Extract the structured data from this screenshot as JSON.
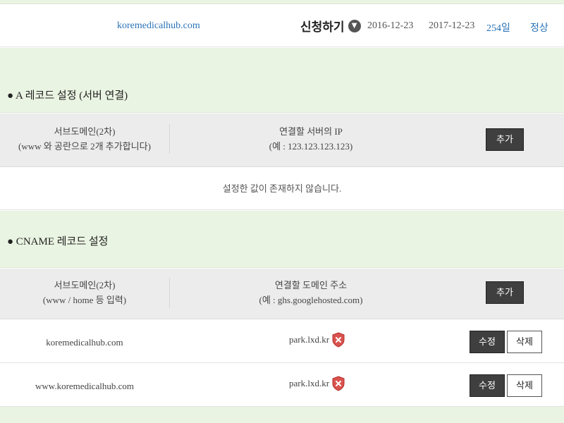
{
  "domain_row": {
    "domain": "koremedicalhub.com",
    "apply_label": "신청하기",
    "start_date": "2016-12-23",
    "end_date": "2017-12-23",
    "days_left": "254일",
    "status": "정상"
  },
  "a_record": {
    "title": "● A 레코드 설정 (서버 연결)",
    "col1_line1": "서브도메인(2차)",
    "col1_line2": "(www 와 공란으로 2개 추가합니다)",
    "col2_line1": "연결할 서버의 IP",
    "col2_line2": "(예 : 123.123.123.123)",
    "add_label": "추가",
    "empty_message": "설정한 값이 존재하지 않습니다."
  },
  "cname_record": {
    "title": "● CNAME 레코드 설정",
    "col1_line1": "서브도메인(2차)",
    "col1_line2": "(www / home 등 입력)",
    "col2_line1": "연결할 도메인 주소",
    "col2_line2": "(예 : ghs.googlehosted.com)",
    "add_label": "추가",
    "rows": [
      {
        "subdomain": "koremedicalhub.com",
        "target": "park.lxd.kr",
        "edit_label": "수정",
        "delete_label": "삭제"
      },
      {
        "subdomain": "www.koremedicalhub.com",
        "target": "park.lxd.kr",
        "edit_label": "수정",
        "delete_label": "삭제"
      }
    ]
  },
  "icons": {
    "apply_dropdown": "chevron-down-icon",
    "verify_status": "shield-x-icon"
  },
  "colors": {
    "section_bg": "#eaf4e2",
    "link": "#2a73b8",
    "button_dark": "#3f3f3f",
    "shield_red": "#d9534f"
  }
}
